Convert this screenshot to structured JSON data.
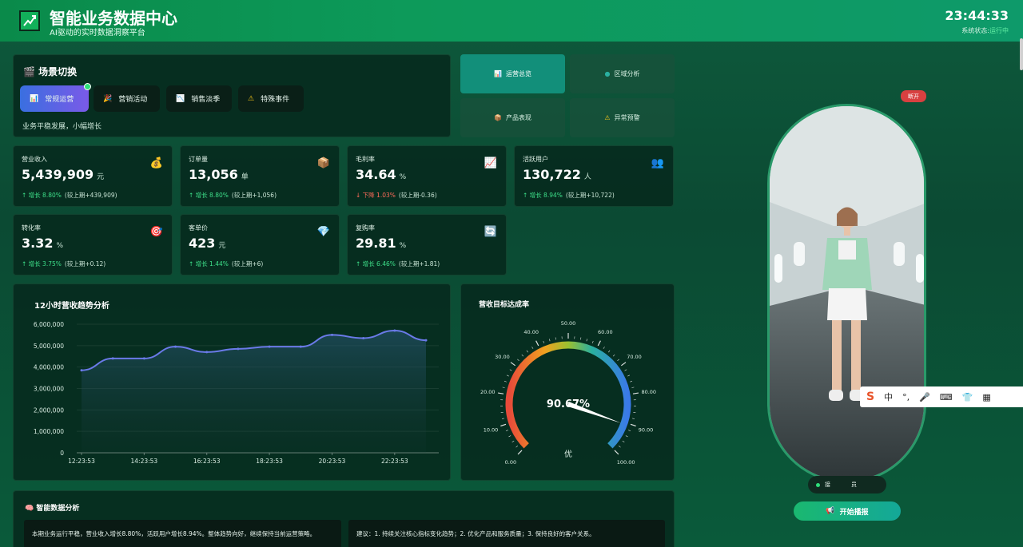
{
  "header": {
    "title": "智能业务数据中心",
    "subtitle": "AI驱动的实时数据洞察平台",
    "clock": "23:44:33",
    "status_label": "系统状态:",
    "status_value": "运行中"
  },
  "scene": {
    "title": "场景切换",
    "buttons": [
      {
        "label": "常规运营",
        "icon": "bar-chart-icon",
        "active": true
      },
      {
        "label": "营销活动",
        "icon": "party-icon",
        "active": false
      },
      {
        "label": "销售淡季",
        "icon": "chart-down-icon",
        "active": false
      },
      {
        "label": "特殊事件",
        "icon": "warning-icon",
        "active": false
      }
    ],
    "description": "业务平稳发展，小幅增长"
  },
  "tabs": [
    {
      "label": "运营总览",
      "active": true
    },
    {
      "label": "区域分析",
      "active": false
    },
    {
      "label": "产品表现",
      "active": false
    },
    {
      "label": "异常预警",
      "active": false
    }
  ],
  "kpis": [
    {
      "label": "营业收入",
      "value": "5,439,909",
      "unit": "元",
      "change": "↑ 增长 8.80%",
      "dir": "up",
      "compare": "(较上期+439,909)",
      "icon": "money-bag-icon"
    },
    {
      "label": "订单量",
      "value": "13,056",
      "unit": "单",
      "change": "↑ 增长 8.80%",
      "dir": "up",
      "compare": "(较上期+1,056)",
      "icon": "package-icon"
    },
    {
      "label": "毛利率",
      "value": "34.64",
      "unit": "%",
      "change": "↓ 下降 1.03%",
      "dir": "down",
      "compare": "(较上期-0.36)",
      "icon": "trend-up-icon"
    },
    {
      "label": "活跃用户",
      "value": "130,722",
      "unit": "人",
      "change": "↑ 增长 8.94%",
      "dir": "up",
      "compare": "(较上期+10,722)",
      "icon": "users-icon"
    },
    {
      "label": "转化率",
      "value": "3.32",
      "unit": "%",
      "change": "↑ 增长 3.75%",
      "dir": "up",
      "compare": "(较上期+0.12)",
      "icon": "target-icon"
    },
    {
      "label": "客单价",
      "value": "423",
      "unit": "元",
      "change": "↑ 增长 1.44%",
      "dir": "up",
      "compare": "(较上期+6)",
      "icon": "diamond-icon"
    },
    {
      "label": "复购率",
      "value": "29.81",
      "unit": "%",
      "change": "↑ 增长 6.46%",
      "dir": "up",
      "compare": "(较上期+1.81)",
      "icon": "refresh-icon"
    }
  ],
  "chart_data": [
    {
      "type": "area",
      "title": "12小时营收趋势分析",
      "x_ticks": [
        "12:23:53",
        "14:23:53",
        "16:23:53",
        "18:23:53",
        "20:23:53",
        "22:23:53"
      ],
      "y_ticks": [
        "0",
        "1,000,000",
        "2,000,000",
        "3,000,000",
        "4,000,000",
        "5,000,000",
        "6,000,000"
      ],
      "ylim": [
        0,
        6000000
      ],
      "values": [
        3850000,
        4400000,
        4400000,
        4950000,
        4700000,
        4850000,
        4950000,
        4950000,
        5500000,
        5350000,
        5700000,
        5250000
      ],
      "color": "#6a7ae8"
    },
    {
      "type": "gauge",
      "title": "营收目标达成率",
      "value": 90.67,
      "value_label": "90.67%",
      "rating": "优",
      "range": [
        0,
        100
      ],
      "tick_labels": [
        "0.00",
        "10.00",
        "20.00",
        "30.00",
        "40.00",
        "50.00",
        "60.00",
        "70.00",
        "80.00",
        "90.00",
        "100.00"
      ]
    }
  ],
  "ai": {
    "title": "智能数据分析",
    "summary": "本期业务运行平稳，营业收入增长8.80%，活跃用户增长8.94%。整体趋势向好，继续保持当前运营策略。",
    "advice": "建议：1. 持续关注核心指标变化趋势；2. 优化产品和服务质量；3. 保持良好的客户关系。"
  },
  "avatar": {
    "disconnect": "断开",
    "status_a": "接",
    "status_b": "员",
    "start": "开始播报"
  },
  "ime": {
    "lang": "中",
    "punct": "°,"
  }
}
